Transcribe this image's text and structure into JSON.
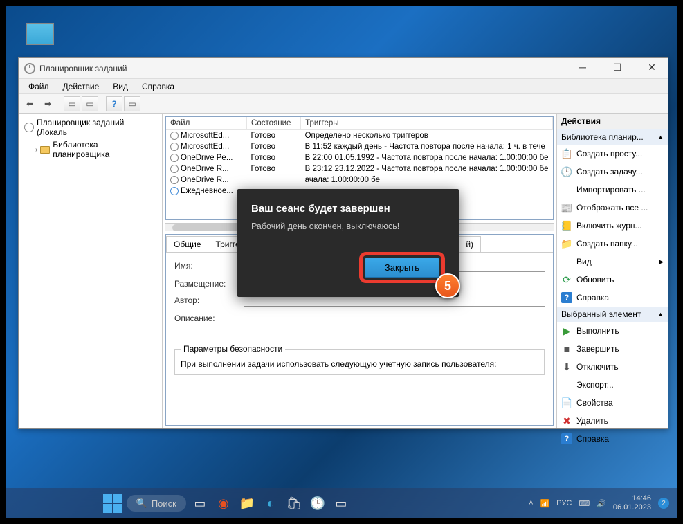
{
  "window": {
    "title": "Планировщик заданий",
    "menu": {
      "file": "Файл",
      "action": "Действие",
      "view": "Вид",
      "help": "Справка"
    }
  },
  "tree": {
    "root": "Планировщик заданий (Локаль",
    "child": "Библиотека планировщика"
  },
  "tasklist": {
    "cols": {
      "file": "Файл",
      "state": "Состояние",
      "triggers": "Триггеры"
    },
    "rows": [
      {
        "name": "MicrosoftEd...",
        "state": "Готово",
        "trigger": "Определено несколько триггеров"
      },
      {
        "name": "MicrosoftEd...",
        "state": "Готово",
        "trigger": "В 11:52 каждый день - Частота повтора после начала: 1 ч. в тече"
      },
      {
        "name": "OneDrive Pe...",
        "state": "Готово",
        "trigger": "В 22:00 01.05.1992 - Частота повтора после начала: 1.00:00:00 бе"
      },
      {
        "name": "OneDrive R...",
        "state": "Готово",
        "trigger": "В 23:12 23.12.2022 - Частота повтора после начала: 1.00:00:00 бе"
      },
      {
        "name": "OneDrive R...",
        "state": "",
        "trigger": "ачала: 1.00:00:00 бе"
      },
      {
        "name": "Ежедневное...",
        "state": "",
        "trigger": ""
      }
    ]
  },
  "tabs": {
    "general": "Общие",
    "triggers": "Триггер",
    "hist": "й)"
  },
  "details": {
    "name_label": "Имя:",
    "name": "",
    "loc_label": "Размещение:",
    "loc": "",
    "author_label": "Автор:",
    "author": "",
    "desc_label": "Описание:",
    "desc": "",
    "security_legend": "Параметры безопасности",
    "security_text": "При выполнении задачи использовать следующую учетную запись пользователя:"
  },
  "actions": {
    "header": "Действия",
    "section1": "Библиотека планир...",
    "items1": [
      {
        "icon": "📋",
        "label": "Создать просту..."
      },
      {
        "icon": "🕒",
        "label": "Создать задачу..."
      },
      {
        "icon": "",
        "label": "Импортировать ..."
      },
      {
        "icon": "📰",
        "label": "Отображать все ..."
      },
      {
        "icon": "📒",
        "label": "Включить журн..."
      },
      {
        "icon": "📁",
        "label": "Создать папку..."
      }
    ],
    "view": "Вид",
    "refresh": "Обновить",
    "help": "Справка",
    "section2": "Выбранный элемент",
    "items2": [
      {
        "icon": "▶",
        "color": "#3a9b3a",
        "label": "Выполнить"
      },
      {
        "icon": "■",
        "color": "#555",
        "label": "Завершить"
      },
      {
        "icon": "⬇",
        "color": "#555",
        "label": "Отключить"
      },
      {
        "icon": "",
        "label": "Экспорт..."
      },
      {
        "icon": "📄",
        "label": "Свойства"
      },
      {
        "icon": "✖",
        "color": "#d03030",
        "label": "Удалить"
      }
    ]
  },
  "dialog": {
    "title": "Ваш сеанс будет завершен",
    "message": "Рабочий день окончен, выключаюсь!",
    "button": "Закрыть",
    "badge": "5"
  },
  "taskbar": {
    "search": "Поиск",
    "lang": "РУС",
    "time": "14:46",
    "date": "06.01.2023"
  }
}
